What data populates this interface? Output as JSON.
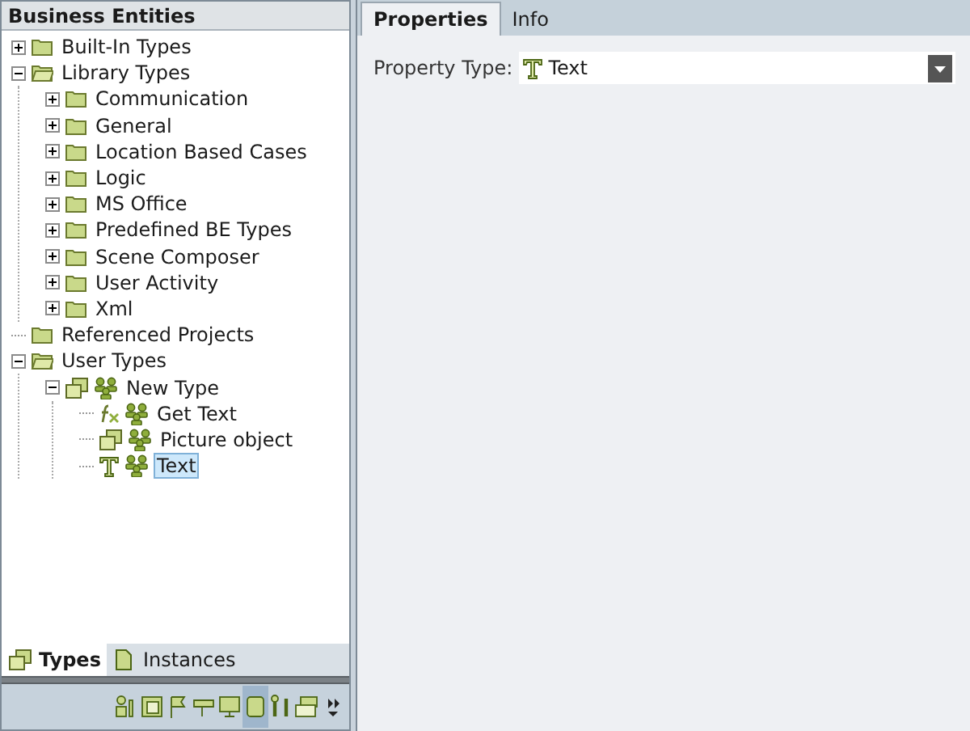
{
  "left_panel": {
    "title": "Business Entities",
    "tree": [
      {
        "label": "Built-In Types",
        "kind": "folder",
        "expanded": false,
        "selected": false
      },
      {
        "label": "Library Types",
        "kind": "folder",
        "expanded": true,
        "selected": false,
        "children": [
          {
            "label": "Communication",
            "kind": "folder",
            "expanded": false,
            "selected": false
          },
          {
            "label": "General",
            "kind": "folder",
            "expanded": false,
            "selected": false
          },
          {
            "label": "Location Based Cases",
            "kind": "folder",
            "expanded": false,
            "selected": false
          },
          {
            "label": "Logic",
            "kind": "folder",
            "expanded": false,
            "selected": false
          },
          {
            "label": "MS Office",
            "kind": "folder",
            "expanded": false,
            "selected": false
          },
          {
            "label": "Predefined BE Types",
            "kind": "folder",
            "expanded": false,
            "selected": false
          },
          {
            "label": "Scene Composer",
            "kind": "folder",
            "expanded": false,
            "selected": false
          },
          {
            "label": "User Activity",
            "kind": "folder",
            "expanded": false,
            "selected": false
          },
          {
            "label": "Xml",
            "kind": "folder",
            "expanded": false,
            "selected": false
          }
        ]
      },
      {
        "label": "Referenced Projects",
        "kind": "folder",
        "selected": false
      },
      {
        "label": "User Types",
        "kind": "folder",
        "expanded": true,
        "selected": false,
        "children": [
          {
            "label": "New Type",
            "kind": "type",
            "expanded": true,
            "selected": false,
            "children": [
              {
                "label": "Get Text",
                "kind": "function",
                "selected": false
              },
              {
                "label": "Picture object",
                "kind": "type",
                "selected": false
              },
              {
                "label": "Text",
                "kind": "text",
                "selected": true
              }
            ]
          }
        ]
      }
    ],
    "tabs": [
      {
        "label": "Types",
        "selected": true
      },
      {
        "label": "Instances",
        "selected": false
      }
    ],
    "toolbar": [
      {
        "kind": "people",
        "selected": false
      },
      {
        "kind": "window",
        "selected": false
      },
      {
        "kind": "flag",
        "selected": false
      },
      {
        "kind": "sign",
        "selected": false
      },
      {
        "kind": "monitor",
        "selected": false
      },
      {
        "kind": "cube",
        "selected": true
      },
      {
        "kind": "tools",
        "selected": false
      },
      {
        "kind": "stack",
        "selected": false
      },
      {
        "kind": "more",
        "selected": false
      }
    ]
  },
  "right_panel": {
    "tabs": [
      {
        "label": "Properties",
        "selected": true
      },
      {
        "label": "Info",
        "selected": false
      }
    ],
    "property_type": {
      "label": "Property Type:",
      "value": "Text"
    }
  }
}
